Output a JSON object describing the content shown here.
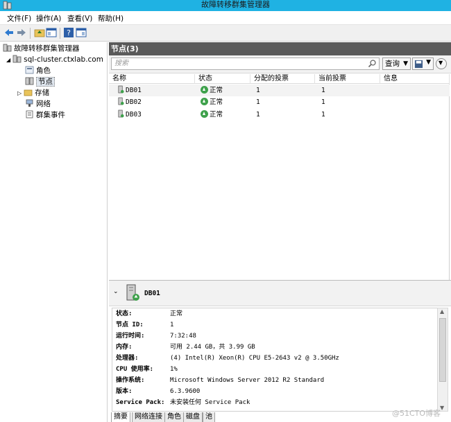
{
  "window": {
    "title": "故障转移群集管理器"
  },
  "menu": [
    "文件(F)",
    "操作(A)",
    "查看(V)",
    "帮助(H)"
  ],
  "tree": {
    "root": "故障转移群集管理器",
    "cluster": "sql-cluster.ctxlab.com",
    "items": [
      "角色",
      "节点",
      "存储",
      "网络",
      "群集事件"
    ]
  },
  "nodes_pane": {
    "title": "节点(3)",
    "search_placeholder": "搜索",
    "query_label": "查询",
    "columns": [
      "名称",
      "状态",
      "分配的投票",
      "当前投票",
      "信息"
    ],
    "rows": [
      {
        "name": "DB01",
        "status": "正常",
        "assigned": "1",
        "current": "1"
      },
      {
        "name": "DB02",
        "status": "正常",
        "assigned": "1",
        "current": "1"
      },
      {
        "name": "DB03",
        "status": "正常",
        "assigned": "1",
        "current": "1"
      }
    ]
  },
  "detail": {
    "node_name": "DB01",
    "fields": [
      {
        "k": "状态:",
        "v": "正常"
      },
      {
        "k": "节点 ID:",
        "v": "1"
      },
      {
        "k": "运行时间:",
        "v": "7:32:48"
      },
      {
        "k": "内存:",
        "v": "可用 2.44 GB，共 3.99 GB"
      },
      {
        "k": "处理器:",
        "v": "(4) Intel(R) Xeon(R) CPU E5-2643 v2 @ 3.50GHz"
      },
      {
        "k": "CPU 使用率:",
        "v": "1%"
      },
      {
        "k": "操作系统:",
        "v": "Microsoft Windows Server 2012 R2 Standard"
      },
      {
        "k": "版本:",
        "v": "6.3.9600"
      },
      {
        "k": "Service Pack:",
        "v": "未安装任何 Service Pack"
      }
    ],
    "tabs": [
      "摘要",
      "网络连接",
      "角色",
      "磁盘",
      "池"
    ]
  },
  "watermark": "@51CTO博客",
  "colors": {
    "titlebar": "#1fb2e3",
    "status_ok": "#3ea14b",
    "pane_header": "#5a5a5a"
  }
}
